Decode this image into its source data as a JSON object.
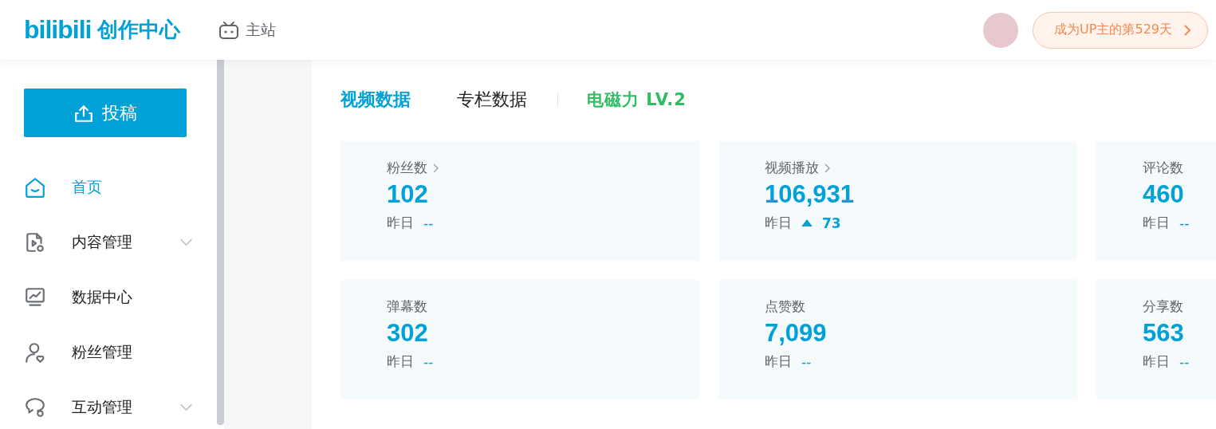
{
  "header": {
    "logo": "bilibili",
    "product": "创作中心",
    "home_link": "主站",
    "days_badge": "成为UP主的第529天"
  },
  "sidebar": {
    "upload_button": "投稿",
    "items": [
      {
        "kind": "home",
        "label": "首页",
        "selected": true,
        "expandable": false
      },
      {
        "kind": "content",
        "label": "内容管理",
        "selected": false,
        "expandable": true
      },
      {
        "kind": "data",
        "label": "数据中心",
        "selected": false,
        "expandable": false
      },
      {
        "kind": "fans",
        "label": "粉丝管理",
        "selected": false,
        "expandable": false
      },
      {
        "kind": "interact",
        "label": "互动管理",
        "selected": false,
        "expandable": true
      }
    ]
  },
  "tabs": [
    {
      "label": "视频数据",
      "selected": true
    },
    {
      "label": "专栏数据",
      "selected": false
    }
  ],
  "level_badge": "电磁力 LV.2",
  "stats": [
    {
      "label": "粉丝数",
      "link": true,
      "value": "102",
      "yesterday_label": "昨日",
      "rising": false,
      "change": "--"
    },
    {
      "label": "视频播放",
      "link": true,
      "value": "106,931",
      "yesterday_label": "昨日",
      "rising": true,
      "change": "73"
    },
    {
      "label": "评论数",
      "link": false,
      "value": "460",
      "yesterday_label": "昨日",
      "rising": false,
      "change": "--"
    },
    {
      "label": "弹幕数",
      "link": false,
      "value": "302",
      "yesterday_label": "昨日",
      "rising": false,
      "change": "--"
    },
    {
      "label": "点赞数",
      "link": false,
      "value": "7,099",
      "yesterday_label": "昨日",
      "rising": false,
      "change": "--"
    },
    {
      "label": "分享数",
      "link": false,
      "value": "563",
      "yesterday_label": "昨日",
      "rising": false,
      "change": "--"
    }
  ]
}
